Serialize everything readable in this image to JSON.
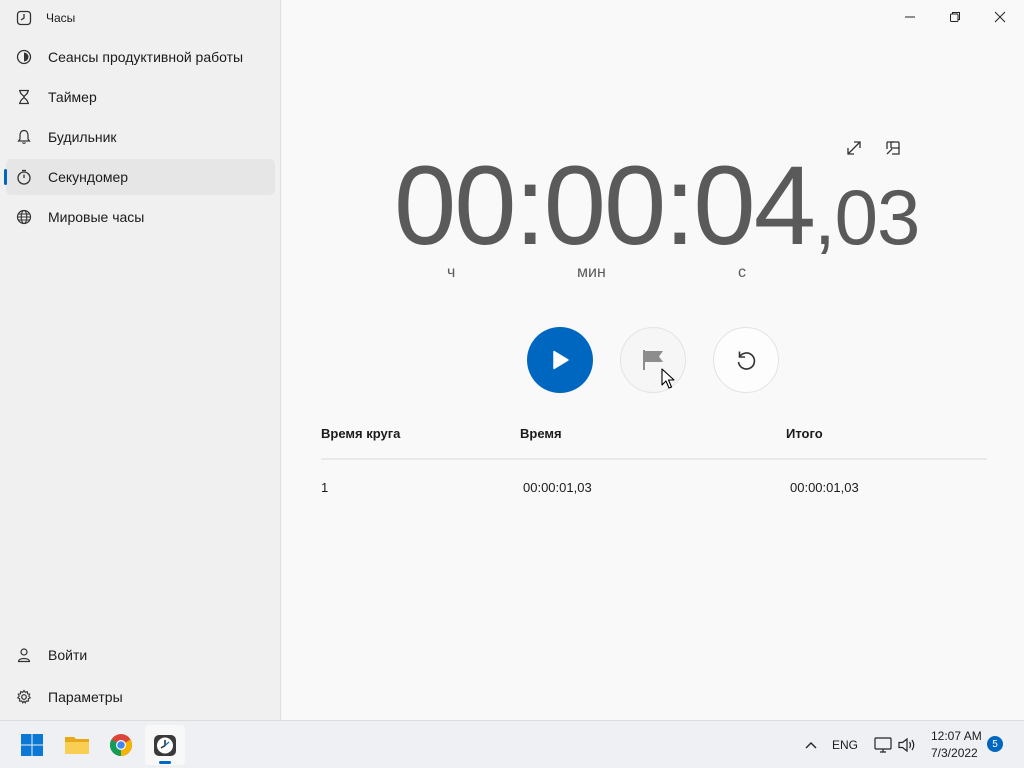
{
  "app": {
    "title": "Часы"
  },
  "sidebar": {
    "items": [
      {
        "label": "Сеансы продуктивной работы",
        "icon": "focus-icon"
      },
      {
        "label": "Таймер",
        "icon": "hourglass-icon"
      },
      {
        "label": "Будильник",
        "icon": "bell-icon"
      },
      {
        "label": "Секундомер",
        "icon": "stopwatch-icon",
        "active": true
      },
      {
        "label": "Мировые часы",
        "icon": "globe-icon"
      }
    ],
    "footer": [
      {
        "label": "Войти",
        "icon": "person-icon"
      },
      {
        "label": "Параметры",
        "icon": "gear-icon"
      }
    ]
  },
  "stopwatch": {
    "hours": "00",
    "minutes": "00",
    "seconds": "04",
    "fraction": ",03",
    "unit_hours": "ч",
    "unit_minutes": "мин",
    "unit_seconds": "с"
  },
  "laps": {
    "headers": {
      "lap": "Время круга",
      "time": "Время",
      "total": "Итого"
    },
    "rows": [
      {
        "lap": "1",
        "time": "00:00:01,03",
        "total": "00:00:01,03"
      }
    ]
  },
  "taskbar": {
    "language": "ENG",
    "time": "12:07 AM",
    "date": "7/3/2022",
    "notification_count": "5"
  },
  "colors": {
    "accent": "#0067c0",
    "digits": "#5a5a5a",
    "sidebar_bg": "#f0f0f0",
    "main_bg": "#f9f9f9"
  }
}
